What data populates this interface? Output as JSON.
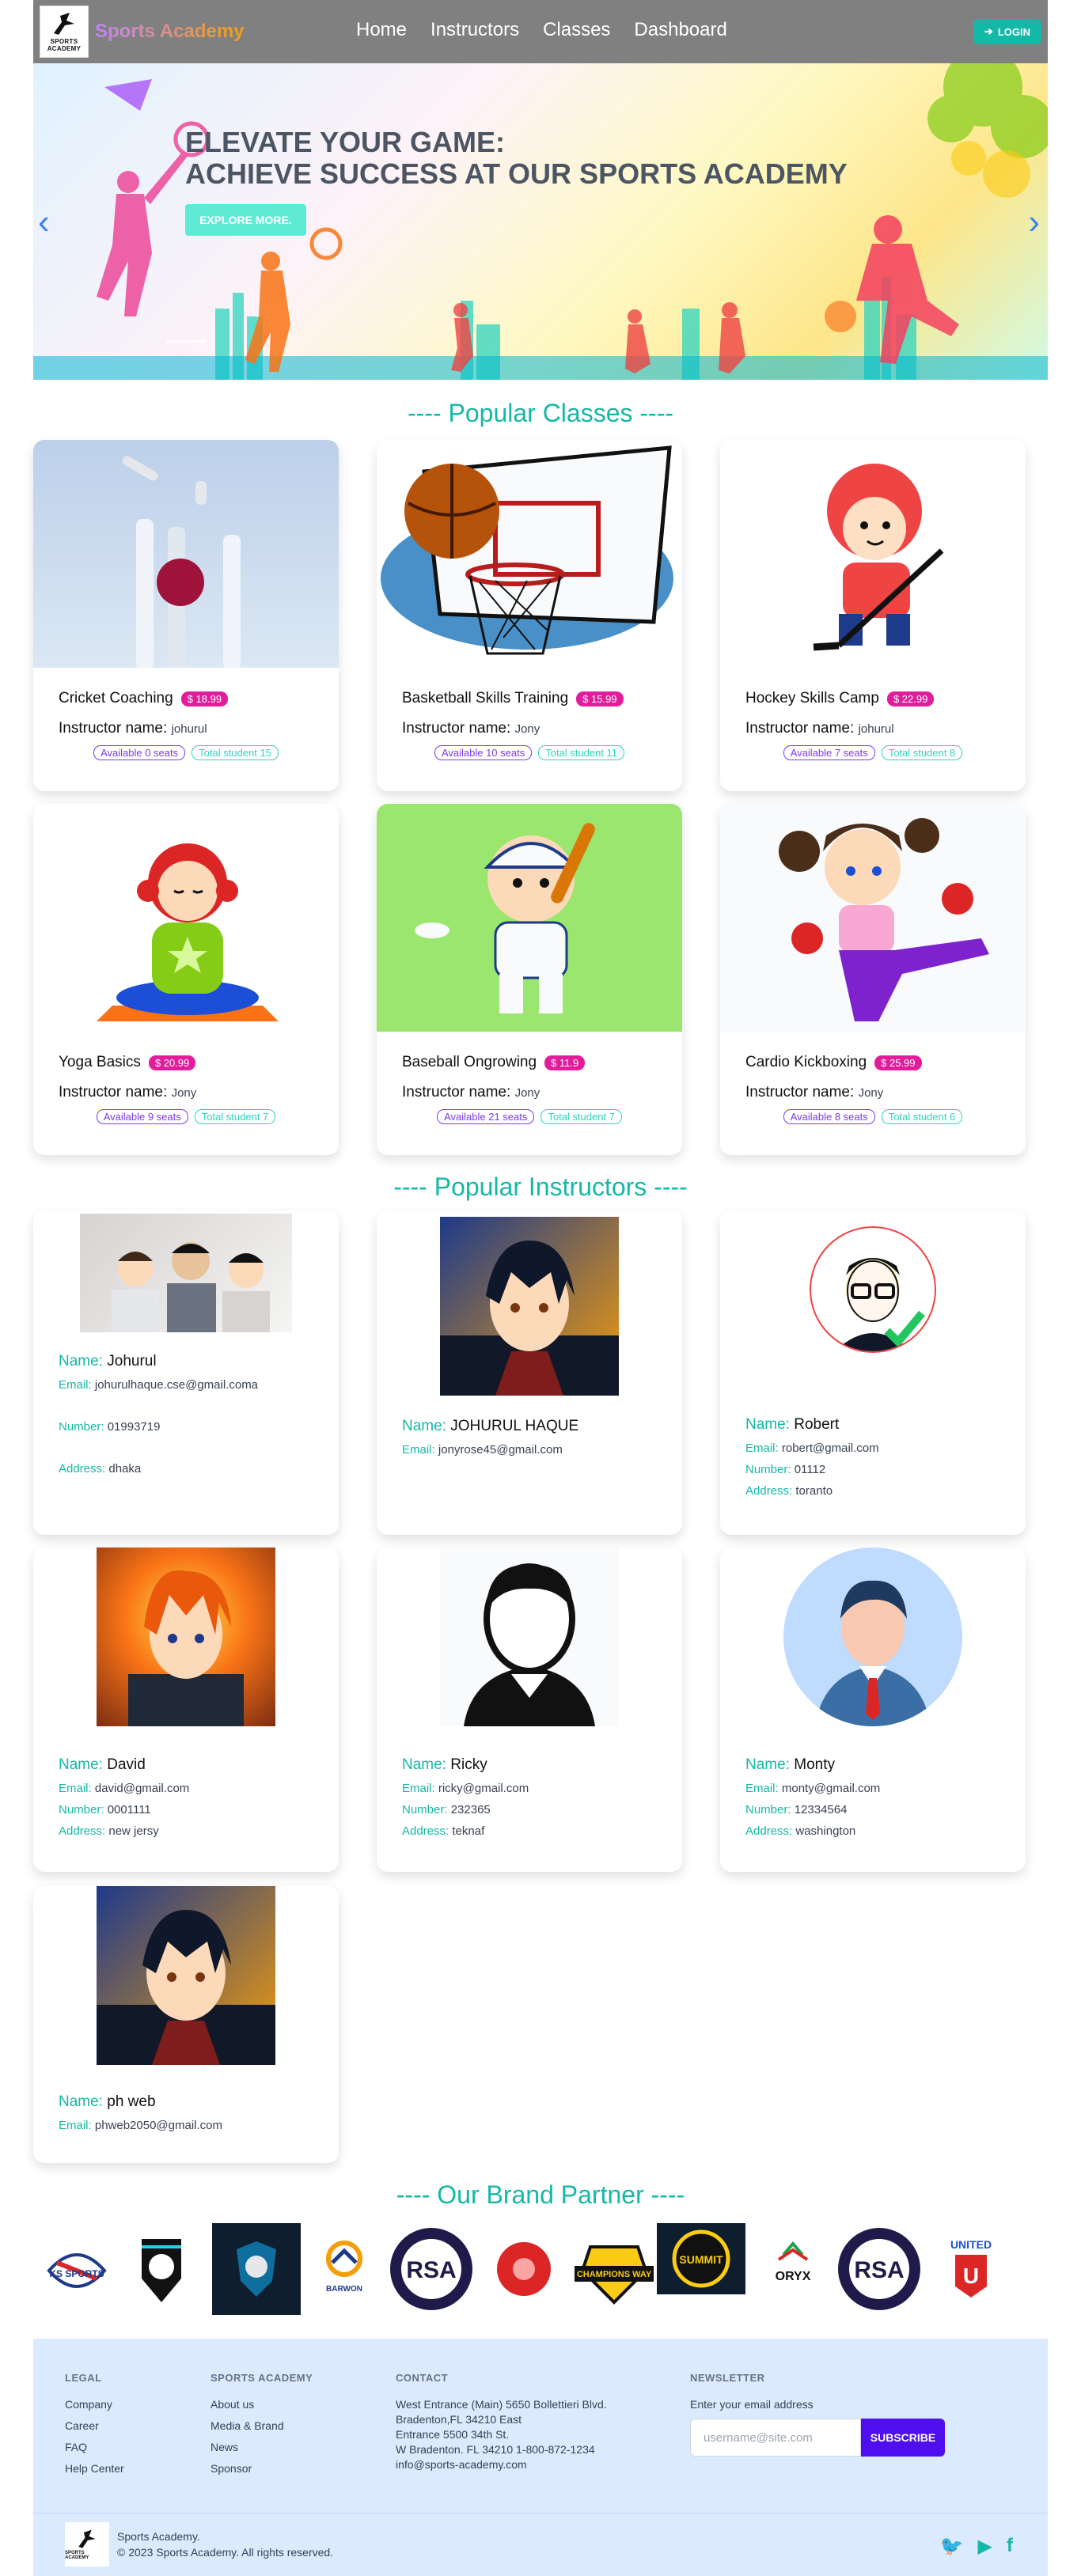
{
  "nav": {
    "logo_text": "SPORTS ACADEMY",
    "brand": "Sports Academy",
    "links": [
      "Home",
      "Instructors",
      "Classes",
      "Dashboard"
    ],
    "login_label": "LOGIN",
    "login_icon": "sign-in-icon"
  },
  "hero": {
    "title_line1": "ELEVATE YOUR GAME:",
    "title_line2": "ACHIEVE SUCCESS AT OUR SPORTS ACADEMY",
    "button": "EXPLORE MORE.",
    "prev_arrow": "‹",
    "next_arrow": "›"
  },
  "popular_classes": {
    "title": "---- Popular Classes ----",
    "items": [
      {
        "name": "Cricket Coaching",
        "price": "$ 18.99",
        "instructor_label": "Instructor name:",
        "instructor": "johurul",
        "seats": "Available 0 seats",
        "total": "Total student 15",
        "image": "cricket-stumps"
      },
      {
        "name": "Basketball Skills Training",
        "price": "$ 15.99",
        "instructor_label": "Instructor name:",
        "instructor": "Jony",
        "seats": "Available 10 seats",
        "total": "Total student 11",
        "image": "basketball-hoop"
      },
      {
        "name": "Hockey Skills Camp",
        "price": "$ 22.99",
        "instructor_label": "Instructor name:",
        "instructor": "johurul",
        "seats": "Available 7 seats",
        "total": "Total student 8",
        "image": "hockey-kid"
      },
      {
        "name": "Yoga Basics",
        "price": "$ 20.99",
        "instructor_label": "Instructor name:",
        "instructor": "Jony",
        "seats": "Available 9 seats",
        "total": "Total student 7",
        "image": "yoga-girl"
      },
      {
        "name": "Baseball Ongrowing",
        "price": "$ 11.9",
        "instructor_label": "Instructor name:",
        "instructor": "Jony",
        "seats": "Available 21 seats",
        "total": "Total student 7",
        "image": "baseball-kid"
      },
      {
        "name": "Cardio Kickboxing",
        "price": "$ 25.99",
        "instructor_label": "Instructor name:",
        "instructor": "Jony",
        "seats": "Available 8 seats",
        "total": "Total student 6",
        "image": "kickboxing-girl"
      }
    ]
  },
  "popular_instructors": {
    "title": "---- Popular Instructors ----",
    "labels": {
      "name": "Name:",
      "email": "Email:",
      "number": "Number:",
      "address": "Address:"
    },
    "items": [
      {
        "name": "Johurul",
        "email": "johurulhaque.cse@gmail.coma",
        "number": "01993719",
        "address": "dhaka",
        "image": "group-photo"
      },
      {
        "name": "JOHURUL HAQUE",
        "email": "jonyrose45@gmail.com",
        "image": "anime-boy"
      },
      {
        "name": "Robert",
        "email": "robert@gmail.com",
        "number": "01112",
        "address": "toranto",
        "image": "glasses-man"
      },
      {
        "name": "David",
        "email": "david@gmail.com",
        "number": "0001111",
        "address": "new jersy",
        "image": "fire-anime"
      },
      {
        "name": "Ricky",
        "email": "ricky@gmail.com",
        "number": "232365",
        "address": "teknaf",
        "image": "silhouette"
      },
      {
        "name": "Monty",
        "email": "monty@gmail.com",
        "number": "12334564",
        "address": "washington",
        "image": "business-man"
      },
      {
        "name": "ph web",
        "email": "phweb2050@gmail.com",
        "image": "anime-boy"
      }
    ]
  },
  "brand_partners": {
    "title": "---- Our Brand Partner ----",
    "logos": [
      {
        "name": "KS SPORTS",
        "icon": "ks-sports-logo"
      },
      {
        "name": "",
        "icon": "soccer-shield-logo"
      },
      {
        "name": "",
        "icon": "dark-team-logo"
      },
      {
        "name": "BARWON",
        "icon": "barwon-logo"
      },
      {
        "name": "RSA",
        "icon": "rsa-logo"
      },
      {
        "name": "",
        "icon": "red-ball-logo"
      },
      {
        "name": "CHAMPIONS WAY",
        "icon": "champions-way-logo"
      },
      {
        "name": "SUMMIT",
        "icon": "summit-logo"
      },
      {
        "name": "ORYX",
        "icon": "oryx-logo"
      },
      {
        "name": "RSA",
        "icon": "rsa-logo-2"
      },
      {
        "name": "UNITED",
        "icon": "united-basketball-logo"
      }
    ]
  },
  "footer": {
    "legal": {
      "heading": "LEGAL",
      "items": [
        "Company",
        "Career",
        "FAQ",
        "Help Center"
      ]
    },
    "academy": {
      "heading": "SPORTS ACADEMY",
      "items": [
        "About us",
        "Media & Brand",
        "News",
        "Sponsor"
      ]
    },
    "contact": {
      "heading": "CONTACT",
      "items": [
        "West Entrance (Main) 5650 Bollettieri Blvd.",
        "Bradenton,FL 34210 East",
        "Entrance 5500 34th St.",
        "W Bradenton. FL 34210 1-800-872-1234",
        "info@sports-academy.com"
      ]
    },
    "newsletter": {
      "heading": "NEWSLETTER",
      "label": "Enter your email address",
      "placeholder": "username@site.com",
      "button": "SUBSCRIBE"
    },
    "copyright_line1": "Sports Academy.",
    "copyright_line2": "© 2023 Sports Academy. All rights reserved.",
    "socials": [
      "twitter-icon",
      "youtube-icon",
      "facebook-icon"
    ]
  },
  "colors": {
    "accent": "#14b8a6",
    "price": "#e11d9c",
    "seat": "#7c3aed",
    "subscribe": "#4f0ef0",
    "footer_bg": "#dbeafe"
  }
}
